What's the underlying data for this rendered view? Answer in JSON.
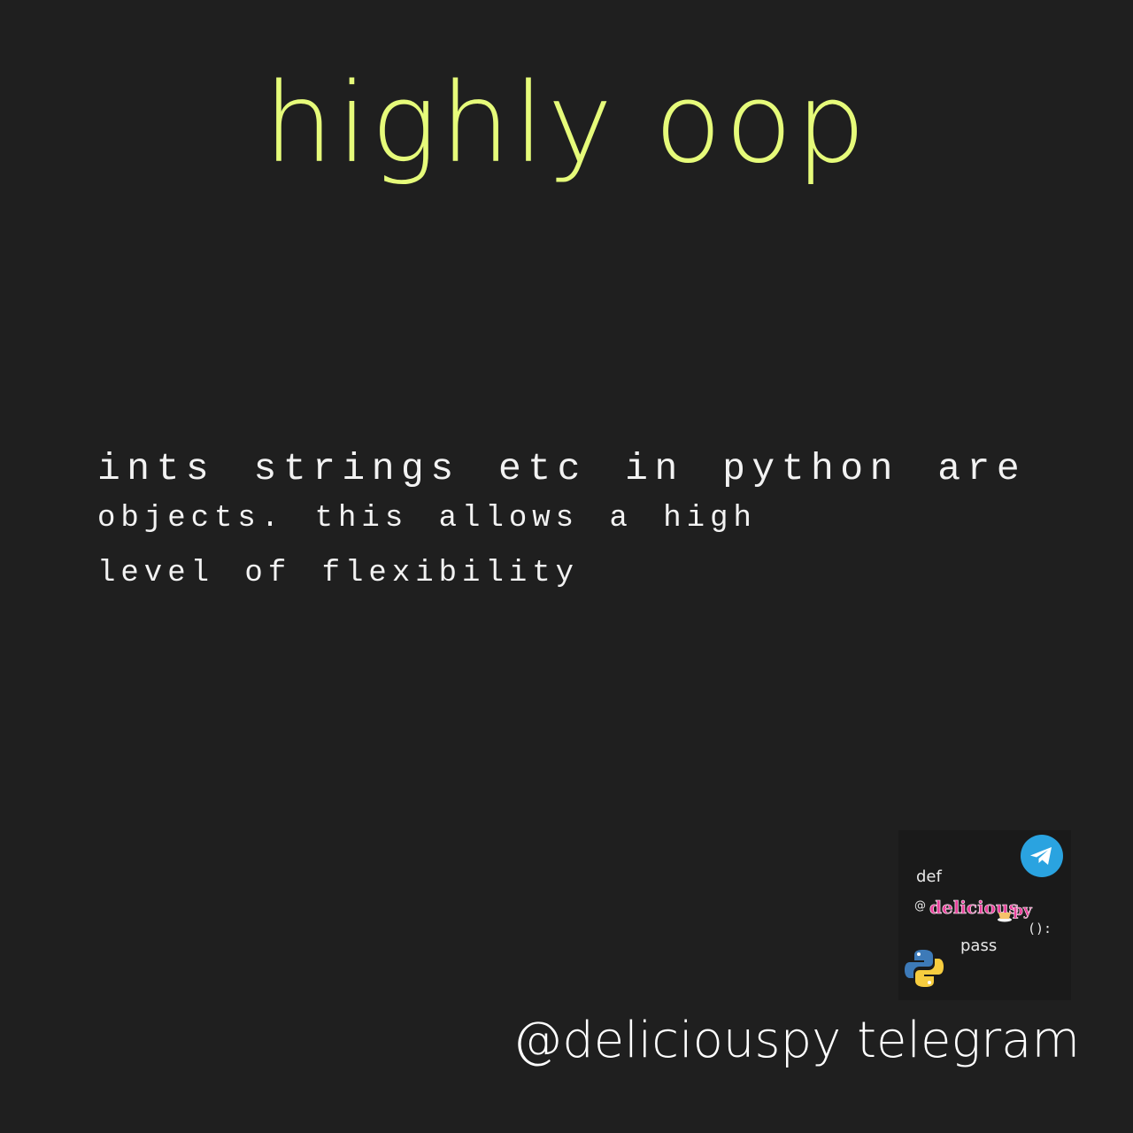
{
  "title": "highly oop",
  "body": {
    "line1": "ints strings etc in python are",
    "line2": "objects. this allows a high",
    "line3": "level of flexibility"
  },
  "logo": {
    "def": "def",
    "at": "@",
    "brand_main": "delicious",
    "brand_suffix": "py",
    "parens": "():",
    "pass": "pass",
    "icons": [
      "telegram-icon",
      "python-icon",
      "coffee-cup-icon"
    ]
  },
  "footer": {
    "handle": "@deliciouspy telegram"
  },
  "colors": {
    "background": "#1f1f1f",
    "title": "#e6fb7a",
    "body_text": "#f2f2f2",
    "telegram": "#2aa3e0",
    "brand_pink": "#e83e9a"
  }
}
